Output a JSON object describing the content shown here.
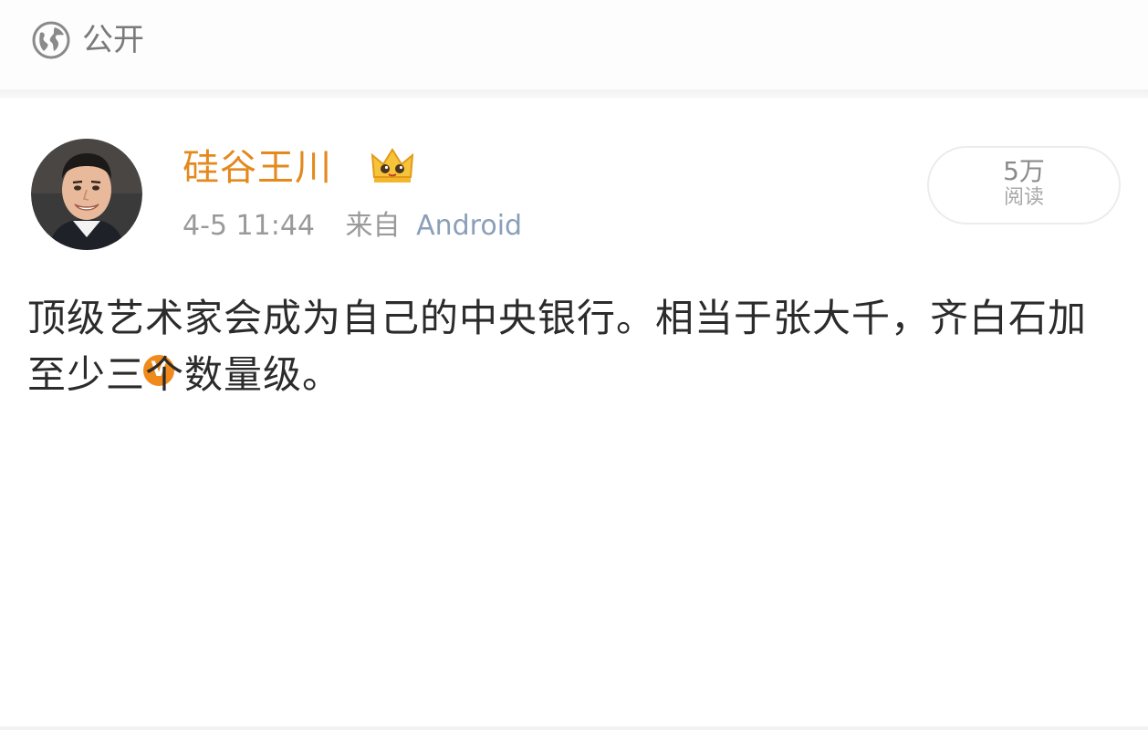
{
  "header": {
    "visibility_icon": "globe-icon",
    "visibility_label": "公开"
  },
  "post": {
    "author": {
      "name": "硅谷王川",
      "avatar": "avatar-photo",
      "verified_icon": "verified-v-icon",
      "verified_letter": "V",
      "vip_icon": "vip-crown-icon"
    },
    "time": "4-5 11:44",
    "source_label": "来自",
    "source_client": "Android",
    "reads": {
      "count": "5万",
      "label": "阅读"
    },
    "text": "顶级艺术家会成为自己的中央银行。相当于张大千，齐白石加至少三个数量级。"
  },
  "colors": {
    "username": "#e3891e",
    "verified_badge": "#f08a1c",
    "meta_text": "#9a9a9a",
    "body_text": "#2b2b2b"
  }
}
